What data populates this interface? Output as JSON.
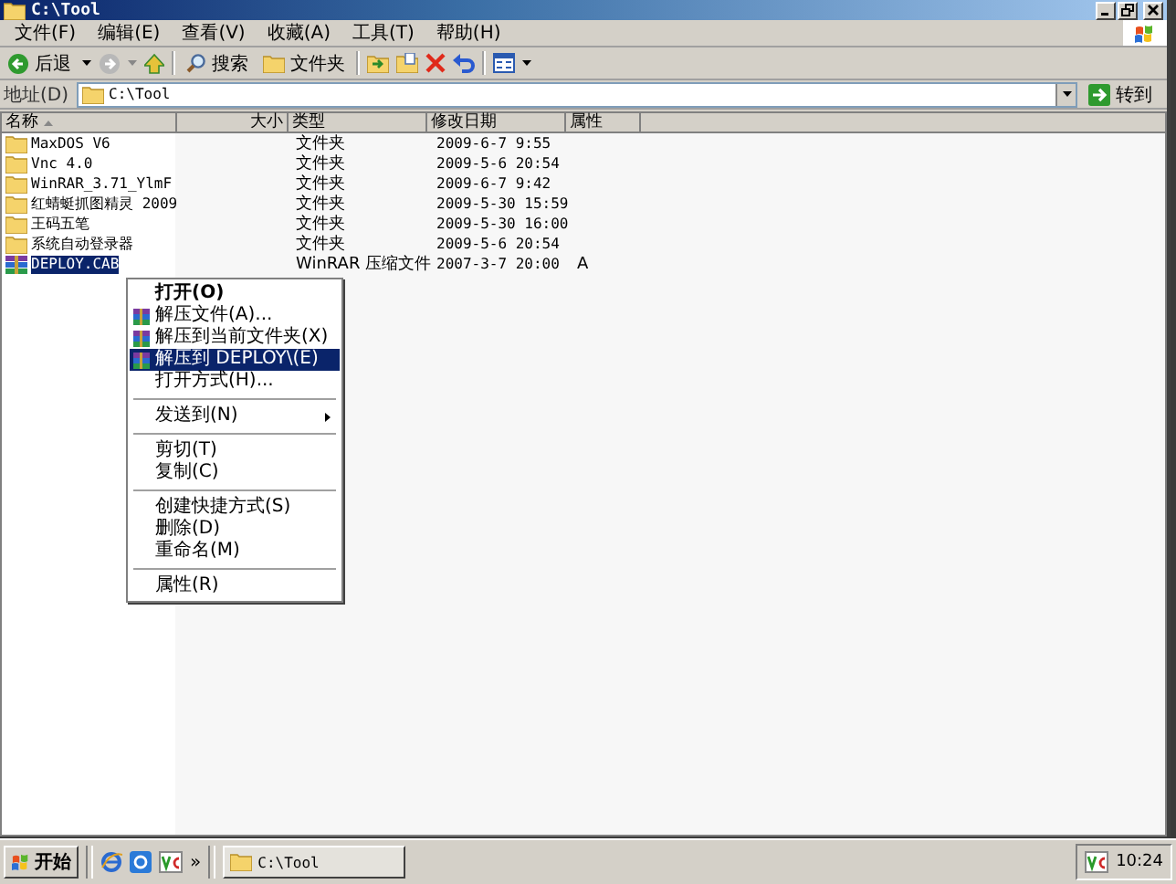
{
  "window": {
    "title": "C:\\Tool"
  },
  "menu": [
    "文件(F)",
    "编辑(E)",
    "查看(V)",
    "收藏(A)",
    "工具(T)",
    "帮助(H)"
  ],
  "toolbar": {
    "back": "后退",
    "search": "搜索",
    "folders": "文件夹"
  },
  "address": {
    "label": "地址(D)",
    "value": "C:\\Tool",
    "go": "转到"
  },
  "columns": [
    "名称",
    "大小",
    "类型",
    "修改日期",
    "属性"
  ],
  "files": [
    {
      "name": "MaxDOS V6",
      "kind": "folder",
      "type": "文件夹",
      "modified": "2009-6-7 9:55",
      "selected": false
    },
    {
      "name": "Vnc 4.0",
      "kind": "folder",
      "type": "文件夹",
      "modified": "2009-5-6 20:54",
      "selected": false
    },
    {
      "name": "WinRAR_3.71_YlmF",
      "kind": "folder",
      "type": "文件夹",
      "modified": "2009-6-7 9:42",
      "selected": false
    },
    {
      "name": "红蜻蜓抓图精灵 2009",
      "kind": "folder",
      "type": "文件夹",
      "modified": "2009-5-30 15:59",
      "selected": false
    },
    {
      "name": "王码五笔",
      "kind": "folder",
      "type": "文件夹",
      "modified": "2009-5-30 16:00",
      "selected": false
    },
    {
      "name": "系统自动登录器",
      "kind": "folder",
      "type": "文件夹",
      "modified": "2009-5-6 20:54",
      "selected": false
    },
    {
      "name": "DEPLOY.CAB",
      "kind": "archive",
      "type": "WinRAR 压缩文件",
      "modified": "2007-3-7 20:00",
      "attributes": "A",
      "selected": true
    }
  ],
  "context_menu": [
    [
      {
        "label": "打开(O)",
        "kind": "plain",
        "default": true,
        "selected": false
      },
      {
        "label": "解压文件(A)...",
        "kind": "archive",
        "default": false,
        "selected": false
      },
      {
        "label": "解压到当前文件夹(X)",
        "kind": "archive",
        "default": false,
        "selected": false
      },
      {
        "label": "解压到 DEPLOY\\(E)",
        "kind": "archive",
        "default": false,
        "selected": true
      },
      {
        "label": "打开方式(H)...",
        "kind": "plain",
        "default": false,
        "selected": false
      }
    ],
    [
      {
        "label": "发送到(N)",
        "kind": "submenu",
        "default": false,
        "selected": false
      }
    ],
    [
      {
        "label": "剪切(T)",
        "kind": "plain",
        "default": false,
        "selected": false
      },
      {
        "label": "复制(C)",
        "kind": "plain",
        "default": false,
        "selected": false
      }
    ],
    [
      {
        "label": "创建快捷方式(S)",
        "kind": "plain",
        "default": false,
        "selected": false
      },
      {
        "label": "删除(D)",
        "kind": "plain",
        "default": false,
        "selected": false
      },
      {
        "label": "重命名(M)",
        "kind": "plain",
        "default": false,
        "selected": false
      }
    ],
    [
      {
        "label": "属性(R)",
        "kind": "plain",
        "default": false,
        "selected": false
      }
    ]
  ],
  "taskbar": {
    "start": "开始",
    "more": "»",
    "tasks": [
      "C:\\Tool"
    ],
    "clock": "10:24"
  }
}
